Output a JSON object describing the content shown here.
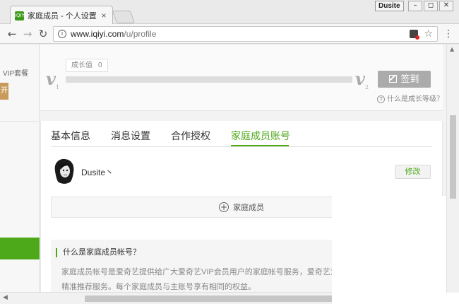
{
  "browser": {
    "tab_title": "家庭成员 - 个人设置 - 爱",
    "tab_close": "×",
    "favicon_text": "iQIYI",
    "user_badge": "Dusite",
    "window_buttons": {
      "minimize": "–",
      "restore": "◻",
      "close": "✕"
    },
    "url_host": "www.iqiyi.com",
    "url_path": "/u/profile",
    "nav": {
      "back": "←",
      "forward": "→",
      "reload": "↻"
    },
    "star": "☆",
    "menu": "⋮",
    "info": "i"
  },
  "sidebar": {
    "vip_label": "VIP套餐",
    "vip_btn": "开"
  },
  "growth": {
    "label": "成长值",
    "value": "0",
    "level_start": "v",
    "level_start_sub": "1",
    "level_end": "v",
    "level_end_sub": "2",
    "progress": 0,
    "checkin_label": "签到",
    "help_text": "什么是成长等级？",
    "help_icon": "?"
  },
  "tabs": [
    {
      "label": "基本信息"
    },
    {
      "label": "消息设置"
    },
    {
      "label": "合作授权"
    },
    {
      "label": "家庭成员账号"
    }
  ],
  "member": {
    "name": "Dusite丶",
    "modify_label": "修改"
  },
  "add_member": {
    "plus": "+",
    "label": "家庭成员"
  },
  "faq": {
    "title": "什么是家庭成员帐号？",
    "line1": "家庭成员帐号是爱奇艺提供给广大爱奇艺VIP会员用户的家庭帐号服务，爱奇艺为每",
    "line2": "精准推荐服务。每个家庭成员与主账号享有相同的权益。"
  },
  "colors": {
    "accent": "#4ea91a",
    "checkin_bg": "#ababab",
    "vip_gold": "#c89b5a"
  }
}
